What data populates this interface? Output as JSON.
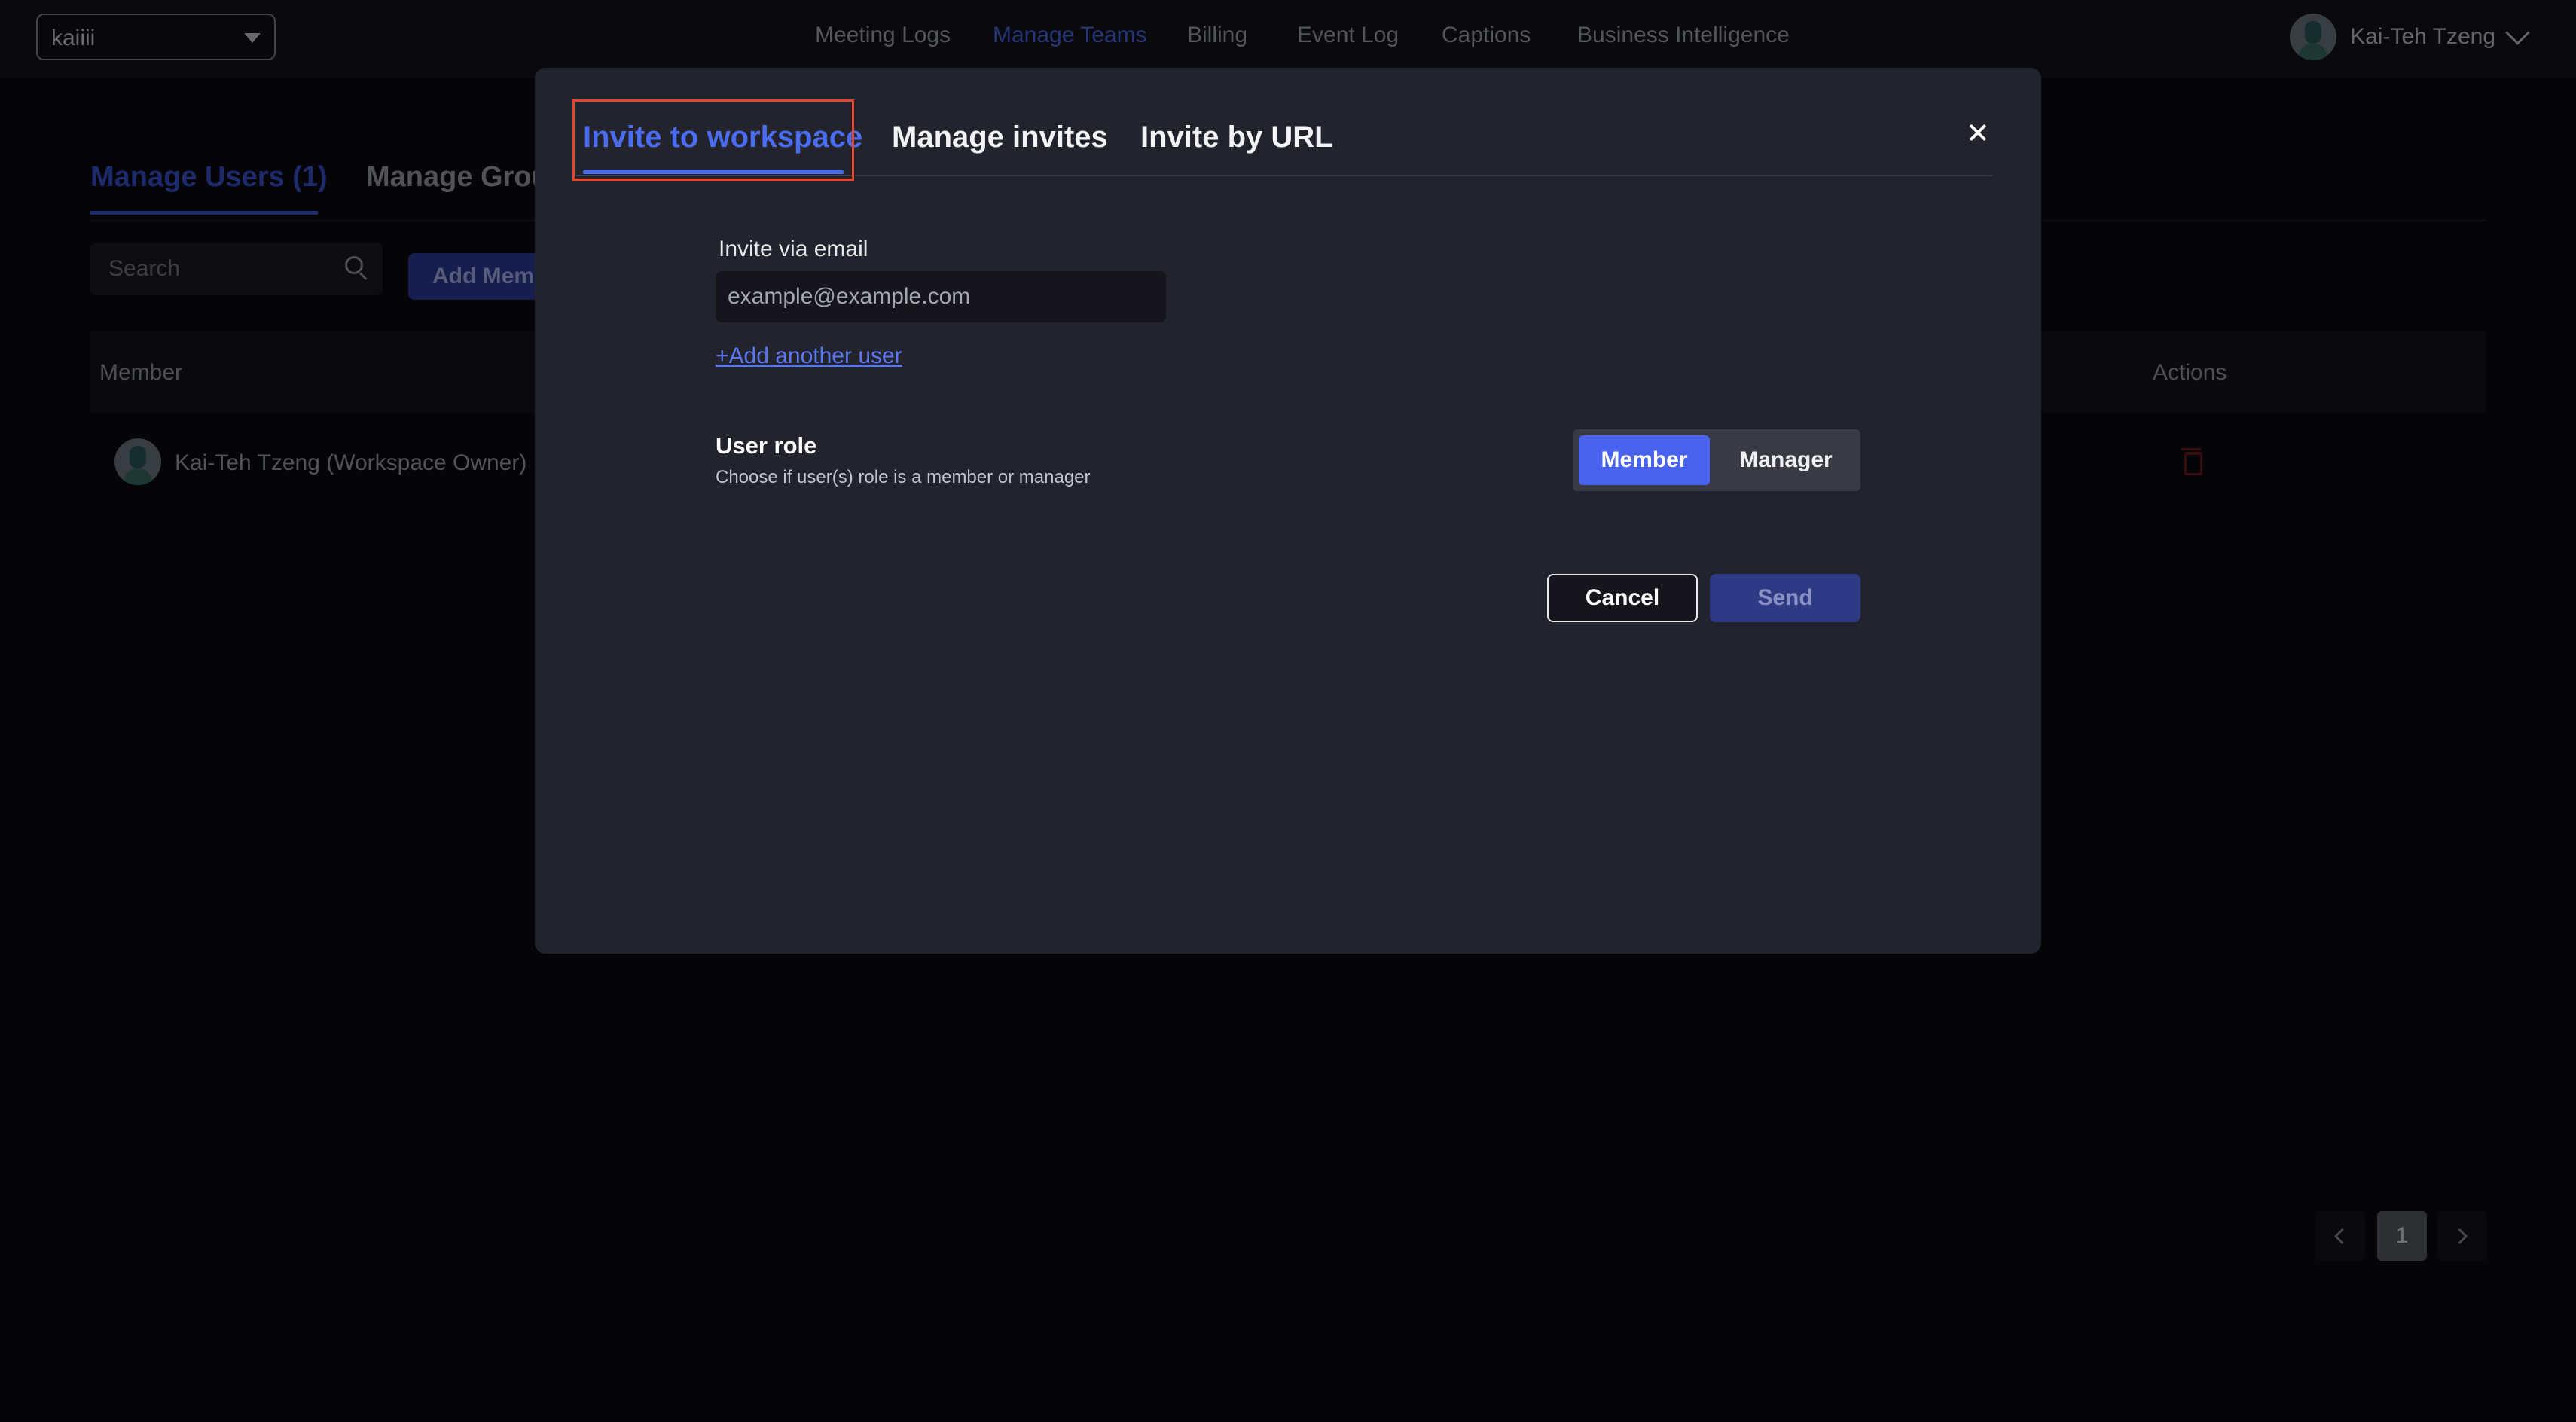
{
  "header": {
    "workspace_select": "kaiiii",
    "nav": [
      "Meeting Logs",
      "Manage Teams",
      "Billing",
      "Event Log",
      "Captions",
      "Business Intelligence"
    ],
    "active_nav": "Manage Teams",
    "user_name": "Kai-Teh Tzeng"
  },
  "page": {
    "tabs": [
      "Manage Users (1)",
      "Manage Grou"
    ],
    "search_placeholder": "Search",
    "add_member_label": "Add Memb",
    "table": {
      "columns": [
        "Member",
        "Actions"
      ],
      "rows": [
        {
          "member": "Kai-Teh Tzeng (Workspace Owner)"
        }
      ]
    },
    "pagination": {
      "current_page": "1"
    }
  },
  "modal": {
    "tabs": [
      "Invite to workspace",
      "Manage invites",
      "Invite by URL"
    ],
    "active_tab": "Invite to workspace",
    "invite_label": "Invite via email",
    "email_placeholder": "example@example.com",
    "add_user_link": "+Add another user",
    "role_title": "User role",
    "role_subtitle": "Choose if user(s) role is a member or manager",
    "roles": [
      "Member",
      "Manager"
    ],
    "selected_role": "Member",
    "cancel_label": "Cancel",
    "send_label": "Send"
  },
  "colors": {
    "accent": "#4a6cf0",
    "highlight_box": "#e8432d",
    "modal_bg": "#23232d",
    "page_bg": "#0b0b0e"
  },
  "icons": [
    "chevron-down-icon",
    "search-icon",
    "trash-icon",
    "close-icon",
    "chevron-left-icon",
    "chevron-right-icon"
  ]
}
